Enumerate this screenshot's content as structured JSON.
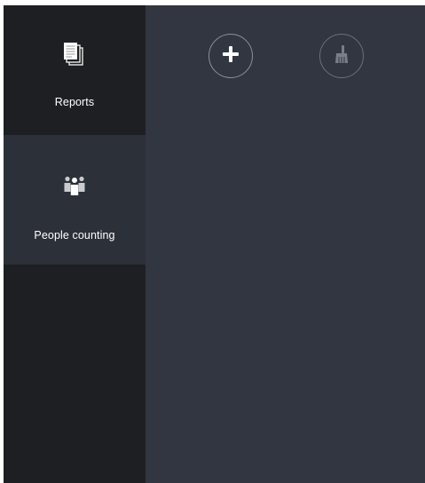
{
  "sidebar": {
    "items": [
      {
        "label": "Reports",
        "icon": "documents-icon",
        "active": false
      },
      {
        "label": "People counting",
        "icon": "people-group-icon",
        "active": true
      }
    ]
  },
  "toolbar": {
    "buttons": [
      {
        "icon": "plus-icon",
        "enabled": true
      },
      {
        "icon": "broom-icon",
        "enabled": false
      }
    ]
  },
  "colors": {
    "sidebar_bg": "#1e1f23",
    "sidebar_active_bg": "#2c3039",
    "main_bg": "#323640",
    "text": "#ffffff"
  }
}
